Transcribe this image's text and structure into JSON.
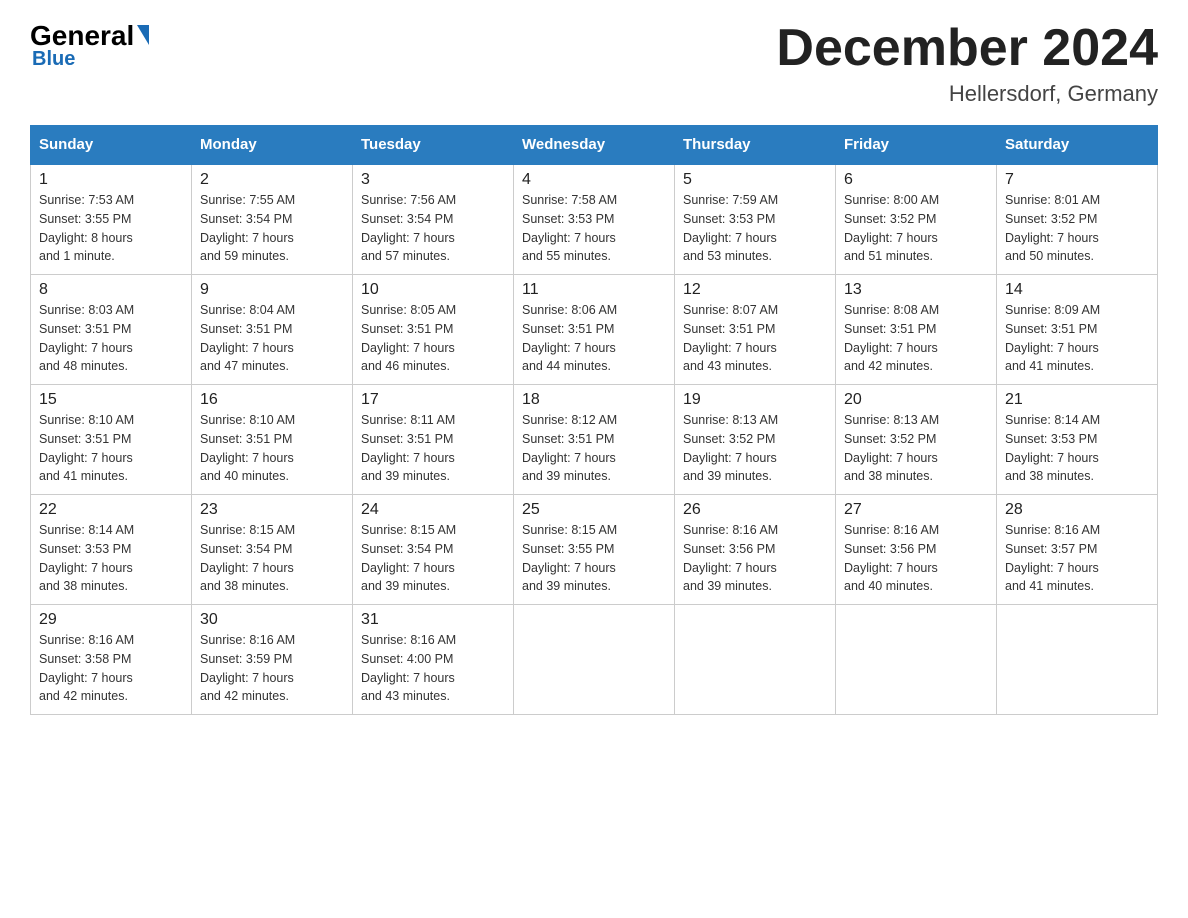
{
  "header": {
    "logo_general": "General",
    "logo_blue": "Blue",
    "month_title": "December 2024",
    "location": "Hellersdorf, Germany"
  },
  "days_of_week": [
    "Sunday",
    "Monday",
    "Tuesday",
    "Wednesday",
    "Thursday",
    "Friday",
    "Saturday"
  ],
  "weeks": [
    [
      {
        "day": "1",
        "info": "Sunrise: 7:53 AM\nSunset: 3:55 PM\nDaylight: 8 hours\nand 1 minute."
      },
      {
        "day": "2",
        "info": "Sunrise: 7:55 AM\nSunset: 3:54 PM\nDaylight: 7 hours\nand 59 minutes."
      },
      {
        "day": "3",
        "info": "Sunrise: 7:56 AM\nSunset: 3:54 PM\nDaylight: 7 hours\nand 57 minutes."
      },
      {
        "day": "4",
        "info": "Sunrise: 7:58 AM\nSunset: 3:53 PM\nDaylight: 7 hours\nand 55 minutes."
      },
      {
        "day": "5",
        "info": "Sunrise: 7:59 AM\nSunset: 3:53 PM\nDaylight: 7 hours\nand 53 minutes."
      },
      {
        "day": "6",
        "info": "Sunrise: 8:00 AM\nSunset: 3:52 PM\nDaylight: 7 hours\nand 51 minutes."
      },
      {
        "day": "7",
        "info": "Sunrise: 8:01 AM\nSunset: 3:52 PM\nDaylight: 7 hours\nand 50 minutes."
      }
    ],
    [
      {
        "day": "8",
        "info": "Sunrise: 8:03 AM\nSunset: 3:51 PM\nDaylight: 7 hours\nand 48 minutes."
      },
      {
        "day": "9",
        "info": "Sunrise: 8:04 AM\nSunset: 3:51 PM\nDaylight: 7 hours\nand 47 minutes."
      },
      {
        "day": "10",
        "info": "Sunrise: 8:05 AM\nSunset: 3:51 PM\nDaylight: 7 hours\nand 46 minutes."
      },
      {
        "day": "11",
        "info": "Sunrise: 8:06 AM\nSunset: 3:51 PM\nDaylight: 7 hours\nand 44 minutes."
      },
      {
        "day": "12",
        "info": "Sunrise: 8:07 AM\nSunset: 3:51 PM\nDaylight: 7 hours\nand 43 minutes."
      },
      {
        "day": "13",
        "info": "Sunrise: 8:08 AM\nSunset: 3:51 PM\nDaylight: 7 hours\nand 42 minutes."
      },
      {
        "day": "14",
        "info": "Sunrise: 8:09 AM\nSunset: 3:51 PM\nDaylight: 7 hours\nand 41 minutes."
      }
    ],
    [
      {
        "day": "15",
        "info": "Sunrise: 8:10 AM\nSunset: 3:51 PM\nDaylight: 7 hours\nand 41 minutes."
      },
      {
        "day": "16",
        "info": "Sunrise: 8:10 AM\nSunset: 3:51 PM\nDaylight: 7 hours\nand 40 minutes."
      },
      {
        "day": "17",
        "info": "Sunrise: 8:11 AM\nSunset: 3:51 PM\nDaylight: 7 hours\nand 39 minutes."
      },
      {
        "day": "18",
        "info": "Sunrise: 8:12 AM\nSunset: 3:51 PM\nDaylight: 7 hours\nand 39 minutes."
      },
      {
        "day": "19",
        "info": "Sunrise: 8:13 AM\nSunset: 3:52 PM\nDaylight: 7 hours\nand 39 minutes."
      },
      {
        "day": "20",
        "info": "Sunrise: 8:13 AM\nSunset: 3:52 PM\nDaylight: 7 hours\nand 38 minutes."
      },
      {
        "day": "21",
        "info": "Sunrise: 8:14 AM\nSunset: 3:53 PM\nDaylight: 7 hours\nand 38 minutes."
      }
    ],
    [
      {
        "day": "22",
        "info": "Sunrise: 8:14 AM\nSunset: 3:53 PM\nDaylight: 7 hours\nand 38 minutes."
      },
      {
        "day": "23",
        "info": "Sunrise: 8:15 AM\nSunset: 3:54 PM\nDaylight: 7 hours\nand 38 minutes."
      },
      {
        "day": "24",
        "info": "Sunrise: 8:15 AM\nSunset: 3:54 PM\nDaylight: 7 hours\nand 39 minutes."
      },
      {
        "day": "25",
        "info": "Sunrise: 8:15 AM\nSunset: 3:55 PM\nDaylight: 7 hours\nand 39 minutes."
      },
      {
        "day": "26",
        "info": "Sunrise: 8:16 AM\nSunset: 3:56 PM\nDaylight: 7 hours\nand 39 minutes."
      },
      {
        "day": "27",
        "info": "Sunrise: 8:16 AM\nSunset: 3:56 PM\nDaylight: 7 hours\nand 40 minutes."
      },
      {
        "day": "28",
        "info": "Sunrise: 8:16 AM\nSunset: 3:57 PM\nDaylight: 7 hours\nand 41 minutes."
      }
    ],
    [
      {
        "day": "29",
        "info": "Sunrise: 8:16 AM\nSunset: 3:58 PM\nDaylight: 7 hours\nand 42 minutes."
      },
      {
        "day": "30",
        "info": "Sunrise: 8:16 AM\nSunset: 3:59 PM\nDaylight: 7 hours\nand 42 minutes."
      },
      {
        "day": "31",
        "info": "Sunrise: 8:16 AM\nSunset: 4:00 PM\nDaylight: 7 hours\nand 43 minutes."
      },
      {
        "day": "",
        "info": ""
      },
      {
        "day": "",
        "info": ""
      },
      {
        "day": "",
        "info": ""
      },
      {
        "day": "",
        "info": ""
      }
    ]
  ]
}
